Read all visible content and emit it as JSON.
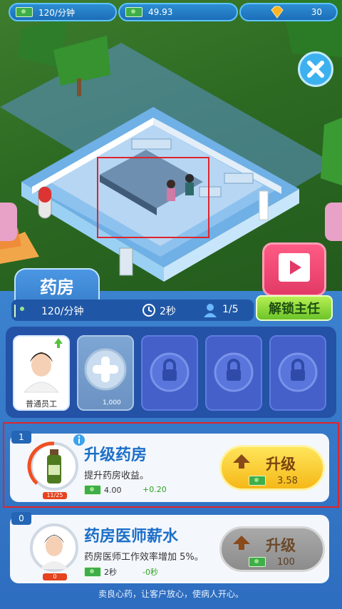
{
  "top_bar": {
    "income_rate": "120/分钟",
    "cash": "49.93",
    "gems": "30"
  },
  "room": {
    "tab_title": "药房",
    "rate": "120/分钟",
    "time": "2秒",
    "staff_count": "1/5",
    "unlock_label": "解锁主任"
  },
  "slots": {
    "staff_label": "普通员工",
    "hire_cost": "1,000"
  },
  "upgrades": [
    {
      "level": "1",
      "title": "升级药房",
      "desc": "提升药房收益。",
      "progress": "11/25",
      "cost": "4.00",
      "gain": "+0.20",
      "button_label": "升级",
      "button_value": "3.58"
    },
    {
      "level": "0",
      "title": "药房医师薪水",
      "desc": "药房医师工作效率增加 5%。",
      "progress": "0",
      "cost": "2秒",
      "gain": "-0秒",
      "button_label": "升级",
      "button_value": "100"
    }
  ],
  "footer_text": "卖良心药，让客户放心，使病人开心。",
  "colors": {
    "accent_blue": "#2e6dbf",
    "green": "#6cc42a",
    "pink": "#e23a66",
    "yellow": "#ffd93a"
  },
  "icons": [
    "money-icon",
    "gem-icon",
    "close-icon",
    "video-icon",
    "clock-icon",
    "person-icon",
    "plus-icon",
    "lock-icon",
    "info-icon",
    "arrow-up-icon",
    "arrow-left-icon",
    "arrow-right-icon"
  ]
}
